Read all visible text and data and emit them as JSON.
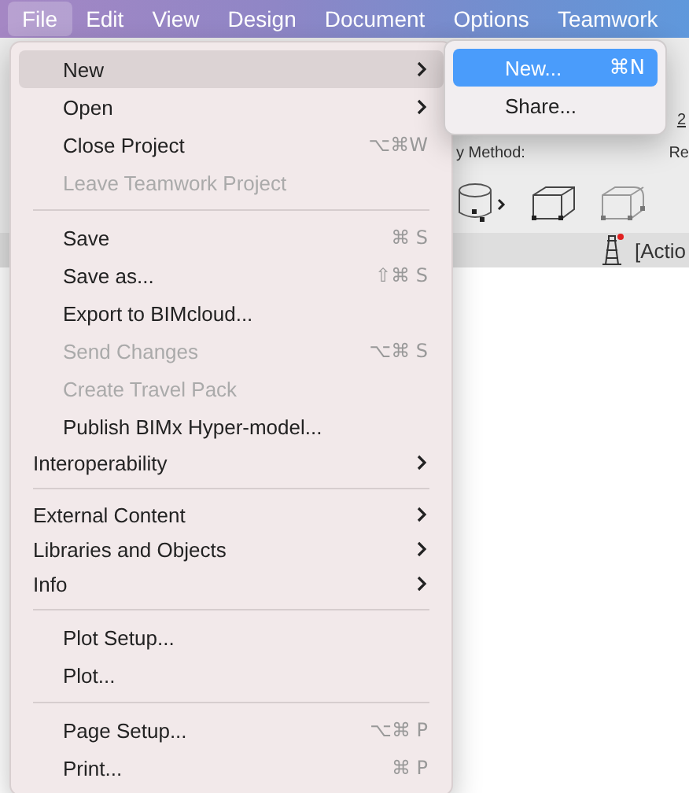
{
  "menu_bar": [
    {
      "label": "File",
      "selected": true
    },
    {
      "label": "Edit",
      "selected": false
    },
    {
      "label": "View",
      "selected": false
    },
    {
      "label": "Design",
      "selected": false
    },
    {
      "label": "Document",
      "selected": false
    },
    {
      "label": "Options",
      "selected": false
    },
    {
      "label": "Teamwork",
      "selected": false
    }
  ],
  "file_menu": [
    {
      "kind": "item",
      "label": "New",
      "submenu": true,
      "selected": true,
      "disabled": false,
      "indented": true
    },
    {
      "kind": "item",
      "label": "Open",
      "submenu": true,
      "selected": false,
      "disabled": false,
      "indented": true
    },
    {
      "kind": "item",
      "label": "Close Project",
      "shortcut": "⌥⌘W",
      "selected": false,
      "disabled": false,
      "indented": true
    },
    {
      "kind": "item",
      "label": "Leave Teamwork Project",
      "selected": false,
      "disabled": true,
      "indented": true
    },
    {
      "kind": "separator"
    },
    {
      "kind": "item",
      "label": "Save",
      "shortcut": "⌘ S",
      "selected": false,
      "disabled": false,
      "indented": true
    },
    {
      "kind": "item",
      "label": "Save as...",
      "shortcut": "⇧⌘ S",
      "selected": false,
      "disabled": false,
      "indented": true
    },
    {
      "kind": "item",
      "label": "Export to BIMcloud...",
      "selected": false,
      "disabled": false,
      "indented": true
    },
    {
      "kind": "item",
      "label": "Send Changes",
      "shortcut": "⌥⌘ S",
      "selected": false,
      "disabled": true,
      "indented": true
    },
    {
      "kind": "item",
      "label": "Create Travel Pack",
      "selected": false,
      "disabled": true,
      "indented": true
    },
    {
      "kind": "item",
      "label": "Publish BIMx Hyper-model...",
      "selected": false,
      "disabled": false,
      "indented": true
    },
    {
      "kind": "item",
      "label": "Interoperability",
      "submenu": true,
      "selected": false,
      "disabled": false,
      "indented": false
    },
    {
      "kind": "separator"
    },
    {
      "kind": "item",
      "label": "External Content",
      "submenu": true,
      "selected": false,
      "disabled": false,
      "indented": false
    },
    {
      "kind": "item",
      "label": "Libraries and Objects",
      "submenu": true,
      "selected": false,
      "disabled": false,
      "indented": false
    },
    {
      "kind": "item",
      "label": "Info",
      "submenu": true,
      "selected": false,
      "disabled": false,
      "indented": false
    },
    {
      "kind": "separator"
    },
    {
      "kind": "item",
      "label": "Plot Setup...",
      "selected": false,
      "disabled": false,
      "indented": true
    },
    {
      "kind": "item",
      "label": "Plot...",
      "selected": false,
      "disabled": false,
      "indented": true
    },
    {
      "kind": "separator"
    },
    {
      "kind": "item",
      "label": "Page Setup...",
      "shortcut": "⌥⌘ P",
      "selected": false,
      "disabled": false,
      "indented": true
    },
    {
      "kind": "item",
      "label": "Print...",
      "shortcut": "⌘ P",
      "selected": false,
      "disabled": false,
      "indented": true
    }
  ],
  "new_submenu": [
    {
      "label": "New...",
      "shortcut": "⌘N",
      "selected": true
    },
    {
      "label": "Share...",
      "selected": false
    }
  ],
  "background": {
    "page_label": "2",
    "method_label": "y Method:",
    "column_label": "Re",
    "status_text": "[Actio"
  }
}
